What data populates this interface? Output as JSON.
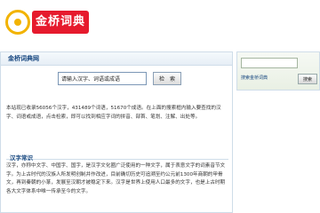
{
  "header": {
    "logo_text": "金桥词典"
  },
  "left": {
    "title": "金桥词典网",
    "search": {
      "value": "请输入汉字、词语或成语",
      "button": "检　索"
    },
    "description": "本站现已收录56056个汉字，431489个词语，51670个成语。在上面的搜索框内输入要查找的汉字、词语或成语，点击检索，即可以找到相应字词的拼音、部首、笔划、注解、出处等。",
    "section_title": "汉字常识",
    "body": "汉字，亦称中文字、中国字、国字，是汉字文化圈广泛使用的一种文字，属于表意文字的词素音节文字。为上古时代的汉族人所发明创制并作改进，目前确切历史可追溯至约公元前1300年商朝的甲骨文，再到秦朝的小篆，发展至汉朝才被稳定下来。汉字是世界上使用人口最多的文字，也是上古时期各大文字体系中唯一传承至今的文字。"
  },
  "right": {
    "sub_label": "搜索金桥词典",
    "button": "搜索"
  }
}
